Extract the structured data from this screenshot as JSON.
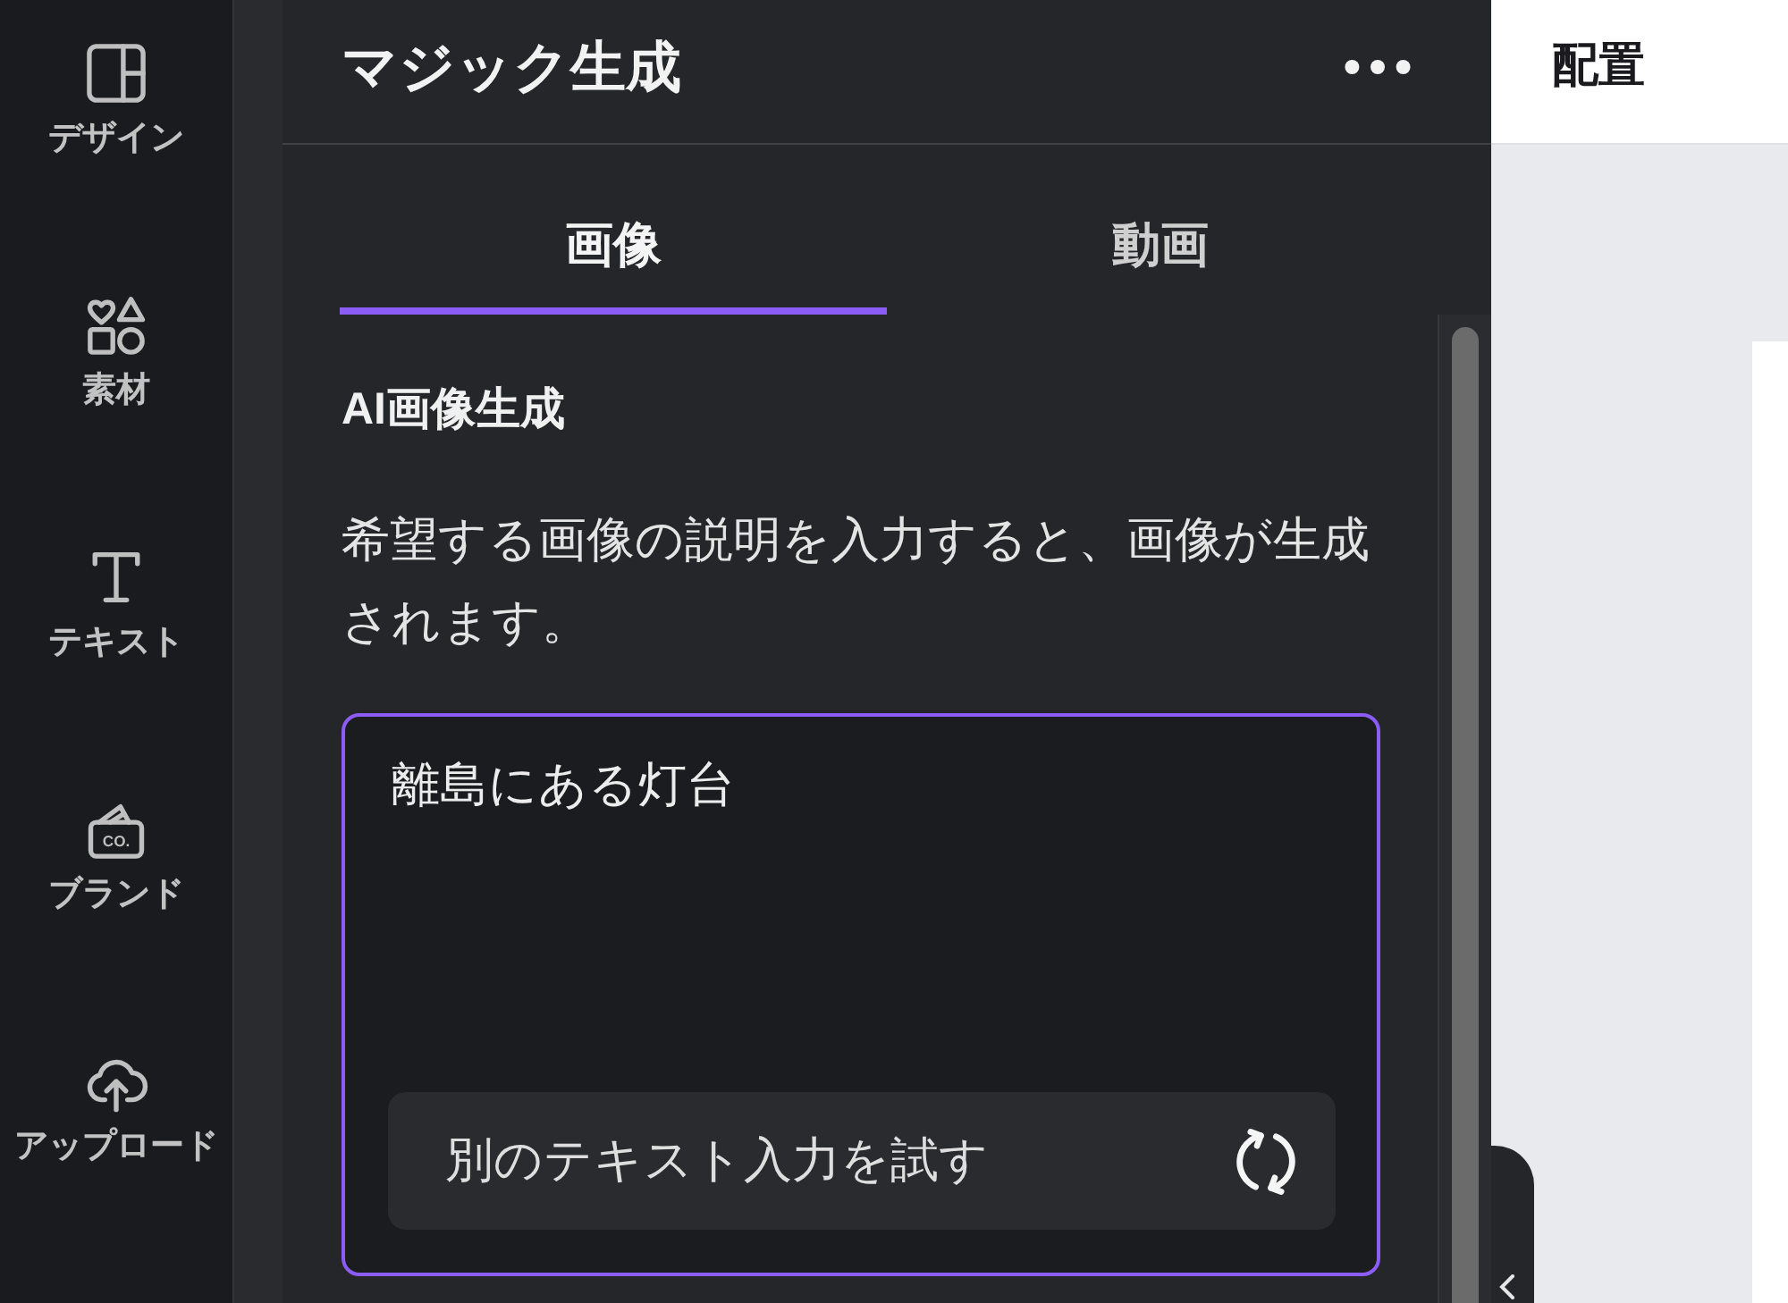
{
  "sidebar": {
    "items": [
      {
        "label": "デザイン"
      },
      {
        "label": "素材"
      },
      {
        "label": "テキスト"
      },
      {
        "label": "ブランド",
        "icon_text": "CO."
      },
      {
        "label": "アップロード"
      }
    ]
  },
  "panel": {
    "title": "マジック生成",
    "tabs": [
      {
        "label": "画像",
        "selected": true
      },
      {
        "label": "動画",
        "selected": false
      }
    ],
    "section_title": "AI画像生成",
    "description": "希望する画像の説明を入力すると、画像が生成されます。",
    "prompt": {
      "value": "離島にある灯台",
      "focused": true,
      "button": "別のテキスト入力を試す"
    }
  },
  "canvas": {
    "toolbar_label": "配置"
  }
}
